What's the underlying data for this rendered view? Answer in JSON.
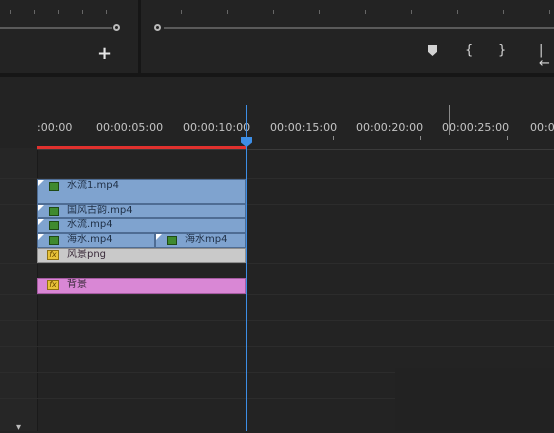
{
  "timeline": {
    "timecodes": [
      ":00:00",
      "00:00:05:00",
      "00:00:10:00",
      "00:00:15:00",
      "00:00:20:00",
      "00:00:25:00",
      "00:00"
    ]
  },
  "monitor": {
    "add_label": "+",
    "marker_icon": "marker-icon",
    "in_icon": "{",
    "out_icon": "}",
    "go_in_icon": "|←"
  },
  "clips": [
    {
      "name": "水流1.mp4",
      "color": "#7fa3cf"
    },
    {
      "name": "国风古韵.mp4",
      "color": "#7fa3cf"
    },
    {
      "name": "水流.mp4",
      "color": "#7fa3cf"
    },
    {
      "name": "海水.mp4",
      "color": "#7fa3cf"
    },
    {
      "name": "海水mp4",
      "color": "#7fa3cf"
    },
    {
      "name": "风景png",
      "color": "#c9c9c9"
    },
    {
      "name": "背景",
      "color": "#d987d5"
    }
  ],
  "colors": {
    "playhead": "#3d8ee6",
    "work_area": "#e0312e"
  }
}
